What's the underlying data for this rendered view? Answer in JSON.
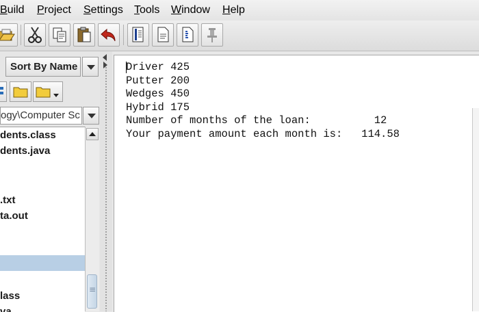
{
  "menubar": {
    "items": [
      {
        "label": "Build",
        "mnemonic": "B",
        "rest": "uild"
      },
      {
        "label": "Project",
        "mnemonic": "P",
        "rest": "roject"
      },
      {
        "label": "Settings",
        "mnemonic": "S",
        "rest": "ettings"
      },
      {
        "label": "Tools",
        "mnemonic": "T",
        "rest": "ools"
      },
      {
        "label": "Window",
        "mnemonic": "W",
        "rest": "indow"
      },
      {
        "label": "Help",
        "mnemonic": "H",
        "rest": "elp"
      }
    ]
  },
  "toolbar": {
    "buttons": [
      "open-icon",
      "cut-icon",
      "copy-icon",
      "paste-icon",
      "undo-icon",
      "compile-icon",
      "document-icon",
      "javadoc-icon",
      "pin-icon"
    ]
  },
  "leftpanel": {
    "sort_label": "Sort By Name",
    "path_value": "ogy\\Computer Sc",
    "files": [
      {
        "name": "dents.class",
        "selected": false
      },
      {
        "name": "dents.java",
        "selected": false
      },
      {
        "name": "",
        "selected": false
      },
      {
        "name": "",
        "selected": false
      },
      {
        "name": ".txt",
        "selected": false
      },
      {
        "name": "ta.out",
        "selected": false
      },
      {
        "name": "",
        "selected": false
      },
      {
        "name": "",
        "selected": true
      },
      {
        "name": "",
        "selected": false
      },
      {
        "name": "lass",
        "selected": false
      },
      {
        "name": "va",
        "selected": false
      }
    ]
  },
  "output": {
    "lines": [
      "Driver 425",
      "Putter 200",
      "Wedges 450",
      "Hybrid 175",
      "Number of months of the loan:          12",
      "Your payment amount each month is:   114.58"
    ]
  },
  "colors": {
    "selection": "#b8cfe5",
    "undo_arrow": "#c0281c"
  }
}
